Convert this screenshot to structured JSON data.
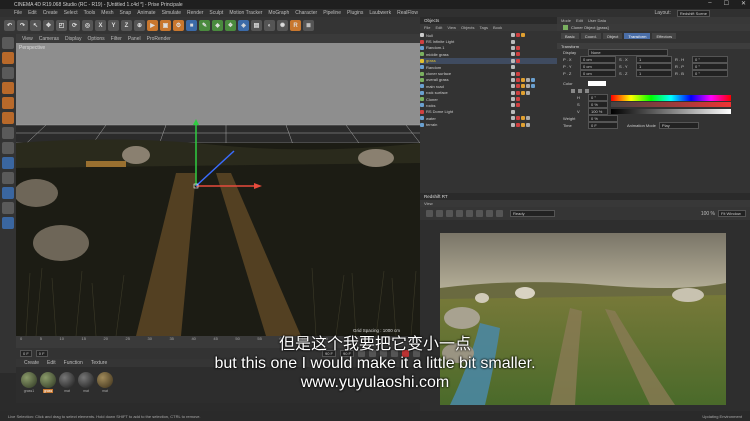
{
  "window": {
    "title": "CINEMA 4D R19.068 Studio (RC - R19) - [Untitled 1.c4d *] - Prise Principale",
    "layout_label": "Layout:",
    "layout_value": "Redshift Scene"
  },
  "menu": [
    "File",
    "Edit",
    "Create",
    "Select",
    "Tools",
    "Mesh",
    "Snap",
    "Animate",
    "Simulate",
    "Render",
    "Sculpt",
    "Motion Tracker",
    "MoGraph",
    "Character",
    "Pipeline",
    "Plugins",
    "Laubwerk",
    "RealFlow",
    "X-Particles",
    "Octane",
    "Redshift",
    "Script",
    "Window",
    "Help"
  ],
  "toolbar": {
    "x_label": "X",
    "y_label": "Y",
    "z_label": "Z"
  },
  "viewport": {
    "menu": [
      "View",
      "Cameras",
      "Display",
      "Options",
      "Filter",
      "Panel",
      "ProRender"
    ],
    "label": "Perspective",
    "grid_spacing": "Grid Spacing : 1000 cm"
  },
  "timeline": {
    "ticks": [
      "0",
      "5",
      "10",
      "15",
      "20",
      "25",
      "30",
      "35",
      "40",
      "45",
      "50",
      "55",
      "60",
      "65",
      "70",
      "75",
      "80",
      "85",
      "90"
    ],
    "start_frame": "0 F",
    "current_frame": "0 F",
    "end_frame": "90 F",
    "end_frame2": "90 F"
  },
  "materials": {
    "menu": [
      "Create",
      "Edit",
      "Function",
      "Texture"
    ],
    "items": [
      {
        "label": "grass1",
        "selected": false
      },
      {
        "label": "grass",
        "selected": true
      },
      {
        "label": "mat",
        "selected": false
      },
      {
        "label": "mat",
        "selected": false
      },
      {
        "label": "mat",
        "selected": false
      }
    ]
  },
  "objects_panel": {
    "title": "Objects",
    "menu": [
      "File",
      "Edit",
      "View",
      "Objects",
      "Tags",
      "Book"
    ],
    "rows": [
      {
        "name": "Null",
        "color": "#cccccc"
      },
      {
        "name": "RS Infinite Light",
        "color": "#d04040"
      },
      {
        "name": "Random.1",
        "color": "#6aa0d0"
      },
      {
        "name": "middle grass",
        "color": "#7ab060"
      },
      {
        "name": "grass",
        "color": "#e0c030"
      },
      {
        "name": "Random",
        "color": "#6aa0d0"
      },
      {
        "name": "cloner surface",
        "color": "#7ab060"
      },
      {
        "name": "overall grass",
        "color": "#7ab060"
      },
      {
        "name": "main road",
        "color": "#6aa0d0"
      },
      {
        "name": "rock surface",
        "color": "#6aa0d0"
      },
      {
        "name": "Cloner",
        "color": "#7ab060"
      },
      {
        "name": "rocks",
        "color": "#6aa0d0"
      },
      {
        "name": "RS Dome Light",
        "color": "#d04040"
      },
      {
        "name": "water",
        "color": "#6aa0d0"
      },
      {
        "name": "terrain",
        "color": "#6aa0d0"
      }
    ]
  },
  "attributes_panel": {
    "menu": [
      "Mode",
      "Edit",
      "User Data"
    ],
    "object_title": "Cloner Object [grass]",
    "tabs": [
      "Basic",
      "Coord.",
      "Object",
      "Transform",
      "Effectors"
    ],
    "active_tab": "Transform",
    "section": "Transform",
    "display_label": "Display",
    "display_value": "None",
    "rows": [
      [
        "P . X",
        "0 cm",
        "S . X",
        "1",
        "R . H",
        "0 °"
      ],
      [
        "P . Y",
        "0 cm",
        "S . Y",
        "1",
        "R . P",
        "0 °"
      ],
      [
        "P . Z",
        "0 cm",
        "S . Z",
        "1",
        "R . B",
        "0 °"
      ]
    ],
    "color_label": "Color",
    "h_label": "H",
    "h_value": "0 °",
    "s_label": "S",
    "s_value": "0 %",
    "v_label": "V",
    "v_value": "100 %",
    "weight_label": "Weight",
    "weight_value": "0 %",
    "time_label": "Time",
    "time_value": "0 F",
    "anim_label": "Animation Mode",
    "anim_value": "Play"
  },
  "render_panel": {
    "title": "Redshift RT",
    "menu": [
      "View"
    ],
    "status": "Ready",
    "zoom": "100 %",
    "fit": "Fit Window"
  },
  "status_bar": {
    "left": "Live Selection: Click and drag to select elements. Hold down SHIFT to add to the selection, CTRL to remove.",
    "right": "Updating Environment"
  },
  "subtitles": {
    "zh": "但是这个我要把它变小一点",
    "en": "but this one I would make it a little bit smaller.",
    "url": "www.yuyulaoshi.com"
  }
}
